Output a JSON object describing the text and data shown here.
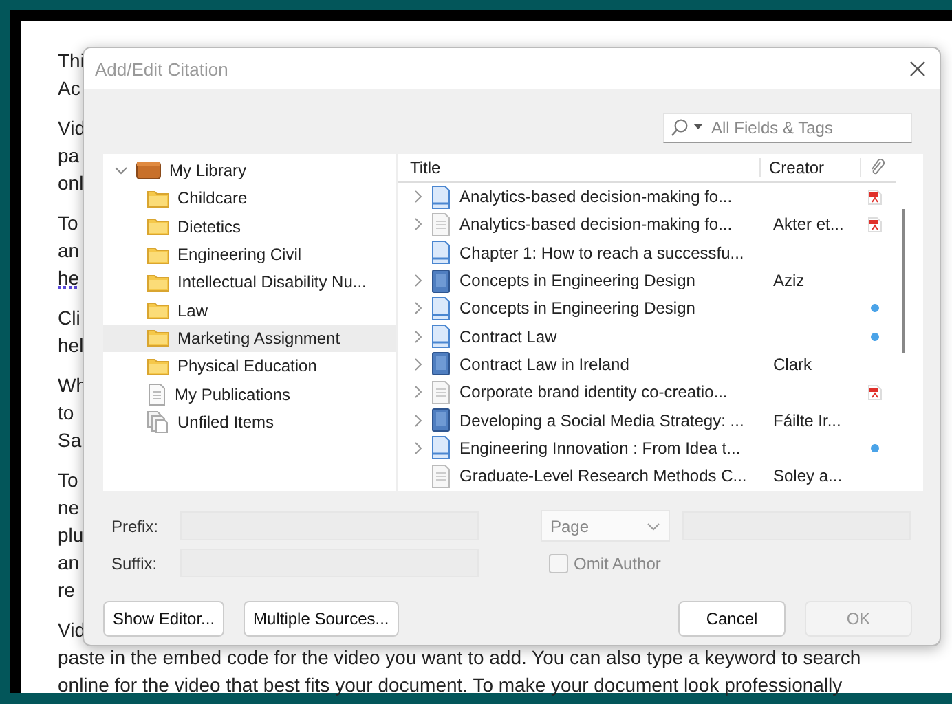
{
  "document": {
    "paragraphs": [
      [
        {
          "text": "Thi",
          "flagged": false
        },
        {
          "text": "Ac",
          "flagged": false
        }
      ],
      [
        {
          "text": "Vid",
          "flagged": false
        },
        {
          "text": "pa",
          "flagged": false
        },
        {
          "text": "onl",
          "flagged": false
        }
      ],
      [
        {
          "text": "To",
          "flagged": false
        },
        {
          "text": "an",
          "flagged": false
        },
        {
          "text": "he",
          "flagged": true
        }
      ],
      [
        {
          "text": "Cli",
          "flagged": false
        },
        {
          "text": "hel",
          "flagged": false
        }
      ],
      [
        {
          "text": "Wh",
          "flagged": false
        },
        {
          "text": "to",
          "flagged": false
        },
        {
          "text": "Sa",
          "flagged": false
        }
      ],
      [
        {
          "text": "To",
          "flagged": false
        },
        {
          "text": "ne",
          "flagged": false
        },
        {
          "text": "plu",
          "flagged": false
        },
        {
          "text": "an",
          "flagged": false
        },
        {
          "text": "re",
          "flagged": false
        }
      ],
      [
        {
          "text": "Vid",
          "flagged": false
        },
        {
          "text": "paste in the embed code for the video you want to add. You can also type a keyword to search",
          "flagged": false
        },
        {
          "text": "online for the video that best fits your document. To make your document look professionally",
          "flagged": false
        }
      ]
    ]
  },
  "dialog": {
    "title": "Add/Edit Citation",
    "active": false,
    "search": {
      "placeholder": "All Fields & Tags"
    },
    "tree": [
      {
        "label": "My Library",
        "kind": "library",
        "expanded": true,
        "selected": false,
        "children": [
          {
            "label": "Childcare",
            "kind": "folder",
            "selected": false
          },
          {
            "label": "Dietetics",
            "kind": "folder",
            "selected": false
          },
          {
            "label": "Engineering Civil",
            "kind": "folder",
            "selected": false
          },
          {
            "label": "Intellectual Disability Nu...",
            "kind": "folder",
            "selected": false
          },
          {
            "label": "Law",
            "kind": "folder",
            "selected": false
          },
          {
            "label": "Marketing Assignment",
            "kind": "folder",
            "selected": true
          },
          {
            "label": "Physical Education",
            "kind": "folder",
            "selected": false
          },
          {
            "label": "My Publications",
            "kind": "publications",
            "selected": false
          },
          {
            "label": "Unfiled Items",
            "kind": "unfiled",
            "selected": false
          }
        ]
      }
    ],
    "table": {
      "columns": [
        "Title",
        "Creator"
      ],
      "rows": [
        {
          "title": "Analytics-based decision-making fo...",
          "creator": "",
          "kind": "journal",
          "expandable": true,
          "pdf": true,
          "dot": false
        },
        {
          "title": "Analytics-based decision-making fo...",
          "creator": "Akter et...",
          "kind": "document",
          "expandable": true,
          "pdf": true,
          "dot": false
        },
        {
          "title": "Chapter 1: How to reach a successfu...",
          "creator": "",
          "kind": "journal",
          "expandable": false,
          "pdf": false,
          "dot": false
        },
        {
          "title": "Concepts in Engineering Design",
          "creator": "Aziz",
          "kind": "book",
          "expandable": true,
          "pdf": false,
          "dot": false
        },
        {
          "title": "Concepts in Engineering Design",
          "creator": "",
          "kind": "journal",
          "expandable": true,
          "pdf": false,
          "dot": true
        },
        {
          "title": "Contract Law",
          "creator": "",
          "kind": "journal",
          "expandable": true,
          "pdf": false,
          "dot": true
        },
        {
          "title": "Contract Law in Ireland",
          "creator": "Clark",
          "kind": "book",
          "expandable": true,
          "pdf": false,
          "dot": false
        },
        {
          "title": "Corporate brand identity co-creatio...",
          "creator": "",
          "kind": "document",
          "expandable": true,
          "pdf": true,
          "dot": false
        },
        {
          "title": "Developing a Social Media Strategy: ...",
          "creator": "Fáilte Ir...",
          "kind": "book",
          "expandable": true,
          "pdf": false,
          "dot": false
        },
        {
          "title": "Engineering Innovation : From Idea t...",
          "creator": "",
          "kind": "journal",
          "expandable": true,
          "pdf": false,
          "dot": true
        },
        {
          "title": "Graduate-Level Research Methods C...",
          "creator": "Soley a...",
          "kind": "document",
          "expandable": false,
          "pdf": false,
          "dot": false
        }
      ]
    },
    "prefix_label": "Prefix:",
    "suffix_label": "Suffix:",
    "locator": {
      "value": "Page",
      "disabled": true
    },
    "omit_author": {
      "label": "Omit Author",
      "checked": false,
      "disabled": true
    },
    "buttons": [
      {
        "label": "Show Editor...",
        "disabled": false
      },
      {
        "label": "Multiple Sources...",
        "disabled": false
      },
      {
        "label": "Cancel",
        "disabled": false
      },
      {
        "label": "OK",
        "disabled": true
      }
    ]
  }
}
